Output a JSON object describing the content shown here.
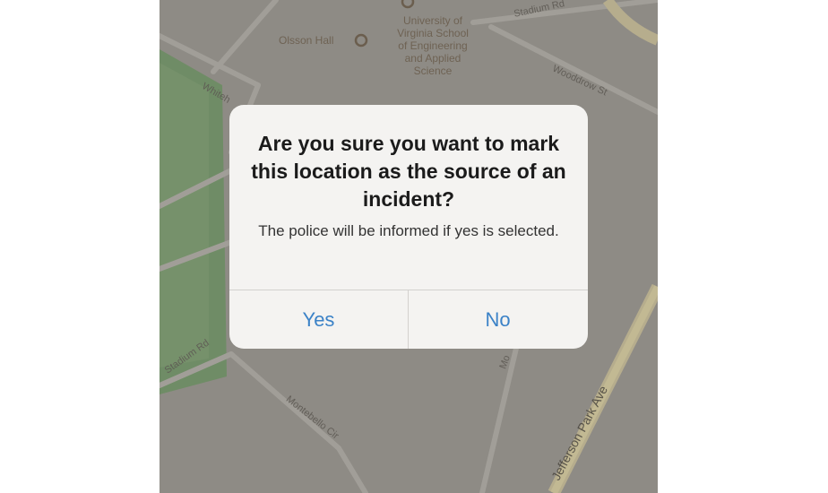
{
  "map": {
    "poi_university": "University of\nVirginia School\nof Engineering\nand Applied\nScience",
    "poi_olsson": "Olsson Hall",
    "street_stadium_top": "Stadium Rd",
    "street_whitehead": "Whiteh",
    "street_wooddrow": "Wooddrow St",
    "street_stadium_bottom": "Stadium Rd",
    "street_montebello": "Montebello Cir",
    "street_jefferson": "Jefferson Park Ave",
    "street_mid": "Mo"
  },
  "alert": {
    "title": "Are you sure you want to mark this location as the source of an incident?",
    "message": "The police will be informed if yes is selected.",
    "yes_label": "Yes",
    "no_label": "No"
  },
  "colors": {
    "map_background": "#8e8b85",
    "grass": "#6f8c66",
    "road": "#a3a09a",
    "alert_background": "#f4f3f1",
    "button_text": "#3b82c7"
  }
}
